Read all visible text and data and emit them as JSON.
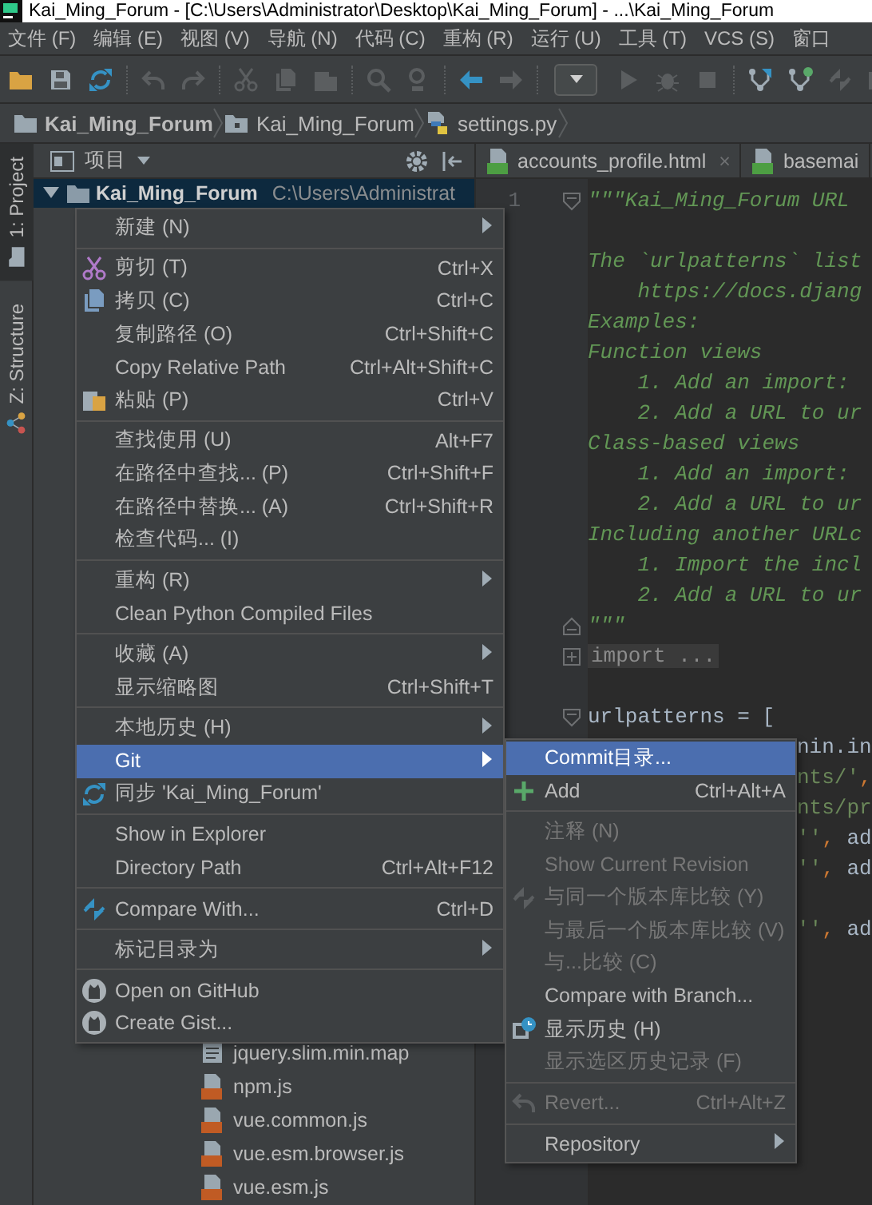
{
  "window": {
    "title": "Kai_Ming_Forum - [C:\\Users\\Administrator\\Desktop\\Kai_Ming_Forum] - ...\\Kai_Ming_Forum"
  },
  "menubar": [
    "文件 (F)",
    "编辑 (E)",
    "视图 (V)",
    "导航 (N)",
    "代码 (C)",
    "重构 (R)",
    "运行 (U)",
    "工具 (T)",
    "VCS (S)",
    "窗口"
  ],
  "toolbar": [
    [
      {
        "kind": "open",
        "disabled": false
      },
      {
        "kind": "save",
        "disabled": false
      },
      {
        "kind": "sync",
        "disabled": false
      }
    ],
    [
      {
        "kind": "undo",
        "disabled": true
      },
      {
        "kind": "redo",
        "disabled": true
      }
    ],
    [
      {
        "kind": "cut",
        "disabled": true
      },
      {
        "kind": "copy",
        "disabled": true
      },
      {
        "kind": "paste",
        "disabled": true
      }
    ],
    [
      {
        "kind": "find",
        "disabled": true
      },
      {
        "kind": "replace",
        "disabled": true
      }
    ],
    [
      {
        "kind": "back",
        "disabled": false
      },
      {
        "kind": "forward",
        "disabled": true
      }
    ],
    [
      {
        "kind": "combo",
        "disabled": false
      },
      {
        "kind": "run",
        "disabled": true
      },
      {
        "kind": "debug",
        "disabled": true
      },
      {
        "kind": "stop",
        "disabled": true
      }
    ],
    [
      {
        "kind": "vcs_update",
        "disabled": false
      },
      {
        "kind": "vcs_commit",
        "disabled": false
      },
      {
        "kind": "compare",
        "disabled": true
      },
      {
        "kind": "history",
        "disabled": true
      }
    ]
  ],
  "breadcrumb": [
    {
      "label": "Kai_Ming_Forum",
      "kind": "project"
    },
    {
      "label": "Kai_Ming_Forum",
      "kind": "folder"
    },
    {
      "label": "settings.py",
      "kind": "file"
    }
  ],
  "tool_strip": [
    {
      "label": "1: Project",
      "selected": true
    },
    {
      "label": "Z: Structure",
      "selected": false
    }
  ],
  "project_panel": {
    "title": "项目",
    "tree": {
      "name": "Kai_Ming_Forum",
      "path": "C:\\Users\\Administrat",
      "expanded": true,
      "selected": true,
      "children": [
        {
          "name": "jquery.slim.min.map",
          "kind": "map"
        },
        {
          "name": "npm.js",
          "kind": "js"
        },
        {
          "name": "vue.common.js",
          "kind": "js"
        },
        {
          "name": "vue.esm.browser.js",
          "kind": "js"
        },
        {
          "name": "vue.esm.js",
          "kind": "js"
        }
      ]
    }
  },
  "editor": {
    "tabs": [
      {
        "label": "accounts_profile.html",
        "close": "×"
      },
      {
        "label": "basemai"
      }
    ],
    "lines": [
      {
        "kind": "fold_start",
        "number": "1",
        "tokens": [
          {
            "text": "\"\"\"Kai_Ming_Forum URL",
            "kind": "doc"
          }
        ]
      },
      {
        "kind": "blank"
      },
      {
        "kind": "code",
        "tokens": [
          {
            "text": "The `urlpatterns` list",
            "kind": "doc"
          }
        ]
      },
      {
        "kind": "code",
        "tokens": [
          {
            "text": "    https://docs.djang",
            "kind": "doc"
          }
        ]
      },
      {
        "kind": "code",
        "tokens": [
          {
            "text": "Examples:",
            "kind": "doc"
          }
        ]
      },
      {
        "kind": "code",
        "tokens": [
          {
            "text": "Function views",
            "kind": "doc"
          }
        ]
      },
      {
        "kind": "code",
        "tokens": [
          {
            "text": "    1. Add an import:",
            "kind": "doc"
          }
        ]
      },
      {
        "kind": "code",
        "tokens": [
          {
            "text": "    2. Add a URL to ur",
            "kind": "doc"
          }
        ]
      },
      {
        "kind": "code",
        "tokens": [
          {
            "text": "Class-based views",
            "kind": "doc"
          }
        ]
      },
      {
        "kind": "code",
        "tokens": [
          {
            "text": "    1. Add an import:",
            "kind": "doc"
          }
        ]
      },
      {
        "kind": "code",
        "tokens": [
          {
            "text": "    2. Add a URL to ur",
            "kind": "doc"
          }
        ]
      },
      {
        "kind": "code",
        "tokens": [
          {
            "text": "Including another URLc",
            "kind": "doc"
          }
        ]
      },
      {
        "kind": "code",
        "tokens": [
          {
            "text": "    1. Import the incl",
            "kind": "doc"
          }
        ]
      },
      {
        "kind": "code",
        "tokens": [
          {
            "text": "    2. Add a URL to ur",
            "kind": "doc"
          }
        ]
      },
      {
        "kind": "fold_end",
        "tokens": [
          {
            "text": "\"\"\"",
            "kind": "doc"
          }
        ]
      },
      {
        "kind": "folded",
        "tokens": [
          {
            "text": "import ...",
            "kind": "folded"
          }
        ]
      },
      {
        "kind": "blank"
      },
      {
        "kind": "fold_start",
        "tokens": [
          {
            "text": "urlpatterns = [",
            "kind": "plain"
          }
        ]
      },
      {
        "kind": "covered",
        "tokens": [
          {
            "text": "nin.in",
            "kind": "plain"
          }
        ]
      },
      {
        "kind": "covered",
        "tokens": [
          {
            "text": "nts/'",
            "kind": "str"
          },
          {
            "text": ",",
            "kind": "kw"
          }
        ]
      },
      {
        "kind": "covered",
        "tokens": [
          {
            "text": "nts/pr",
            "kind": "str"
          }
        ]
      },
      {
        "kind": "covered",
        "tokens": [
          {
            "text": "''",
            "kind": "str"
          },
          {
            "text": ",",
            "kind": "kw"
          },
          {
            "text": " ad",
            "kind": "plain"
          }
        ]
      },
      {
        "kind": "covered",
        "tokens": [
          {
            "text": "''",
            "kind": "str"
          },
          {
            "text": ",",
            "kind": "kw"
          },
          {
            "text": " ad",
            "kind": "plain"
          }
        ]
      },
      {
        "kind": "blank"
      },
      {
        "kind": "covered",
        "tokens": [
          {
            "text": "''",
            "kind": "str"
          },
          {
            "text": ",",
            "kind": "kw"
          },
          {
            "text": " ad",
            "kind": "plain"
          }
        ]
      }
    ]
  },
  "context_menu": {
    "groups": [
      [
        {
          "label": "新建 (N)",
          "submenu": true,
          "selected": false,
          "disabled": false
        }
      ],
      [
        {
          "label": "剪切 (T)",
          "shortcut": "Ctrl+X",
          "submenu": false,
          "selected": false,
          "disabled": false
        },
        {
          "label": "拷贝 (C)",
          "shortcut": "Ctrl+C",
          "submenu": false,
          "selected": false,
          "disabled": false
        },
        {
          "label": "复制路径 (O)",
          "shortcut": "Ctrl+Shift+C",
          "submenu": false,
          "selected": false,
          "disabled": false
        },
        {
          "label": "Copy Relative Path",
          "shortcut": "Ctrl+Alt+Shift+C",
          "submenu": false,
          "selected": false,
          "disabled": false
        },
        {
          "label": "粘贴 (P)",
          "shortcut": "Ctrl+V",
          "submenu": false,
          "selected": false,
          "disabled": false
        }
      ],
      [
        {
          "label": "查找使用 (U)",
          "shortcut": "Alt+F7",
          "submenu": false,
          "selected": false,
          "disabled": false
        },
        {
          "label": "在路径中查找... (P)",
          "shortcut": "Ctrl+Shift+F",
          "submenu": false,
          "selected": false,
          "disabled": false
        },
        {
          "label": "在路径中替换... (A)",
          "shortcut": "Ctrl+Shift+R",
          "submenu": false,
          "selected": false,
          "disabled": false
        },
        {
          "label": "检查代码... (I)",
          "submenu": false,
          "selected": false,
          "disabled": false
        }
      ],
      [
        {
          "label": "重构 (R)",
          "submenu": true,
          "selected": false,
          "disabled": false
        },
        {
          "label": "Clean Python Compiled Files",
          "submenu": false,
          "selected": false,
          "disabled": false
        }
      ],
      [
        {
          "label": "收藏 (A)",
          "submenu": true,
          "selected": false,
          "disabled": false
        },
        {
          "label": "显示缩略图",
          "shortcut": "Ctrl+Shift+T",
          "submenu": false,
          "selected": false,
          "disabled": false
        }
      ],
      [
        {
          "label": "本地历史 (H)",
          "submenu": true,
          "selected": false,
          "disabled": false
        },
        {
          "label": "Git",
          "submenu": true,
          "selected": true,
          "disabled": false
        },
        {
          "label": "同步 'Kai_Ming_Forum'",
          "submenu": false,
          "selected": false,
          "disabled": false
        }
      ],
      [
        {
          "label": "Show in Explorer",
          "submenu": false,
          "selected": false,
          "disabled": false
        },
        {
          "label": "Directory Path",
          "shortcut": "Ctrl+Alt+F12",
          "submenu": false,
          "selected": false,
          "disabled": false
        }
      ],
      [
        {
          "label": "Compare With...",
          "shortcut": "Ctrl+D",
          "submenu": false,
          "selected": false,
          "disabled": false
        }
      ],
      [
        {
          "label": "标记目录为",
          "submenu": true,
          "selected": false,
          "disabled": false
        }
      ],
      [
        {
          "label": "Open on GitHub",
          "submenu": false,
          "selected": false,
          "disabled": false
        },
        {
          "label": "Create Gist...",
          "submenu": false,
          "selected": false,
          "disabled": false
        }
      ]
    ]
  },
  "submenu": {
    "groups": [
      [
        {
          "label": "Commit目录...",
          "submenu": false,
          "selected": true,
          "disabled": false
        },
        {
          "label": "Add",
          "shortcut": "Ctrl+Alt+A",
          "submenu": false,
          "selected": false,
          "disabled": false
        }
      ],
      [
        {
          "label": "注释 (N)",
          "submenu": false,
          "selected": false,
          "disabled": true
        },
        {
          "label": "Show Current Revision",
          "submenu": false,
          "selected": false,
          "disabled": true
        },
        {
          "label": "与同一个版本库比较 (Y)",
          "submenu": false,
          "selected": false,
          "disabled": true
        },
        {
          "label": "与最后一个版本库比较 (V)",
          "submenu": false,
          "selected": false,
          "disabled": true
        },
        {
          "label": "与...比较 (C)",
          "submenu": false,
          "selected": false,
          "disabled": true
        },
        {
          "label": "Compare with Branch...",
          "submenu": false,
          "selected": false,
          "disabled": false
        },
        {
          "label": "显示历史 (H)",
          "submenu": false,
          "selected": false,
          "disabled": false
        },
        {
          "label": "显示选区历史记录 (F)",
          "submenu": false,
          "selected": false,
          "disabled": true
        }
      ],
      [
        {
          "label": "Revert...",
          "shortcut": "Ctrl+Alt+Z",
          "submenu": false,
          "selected": false,
          "disabled": true
        }
      ],
      [
        {
          "label": "Repository",
          "submenu": true,
          "selected": false,
          "disabled": false
        }
      ]
    ]
  }
}
